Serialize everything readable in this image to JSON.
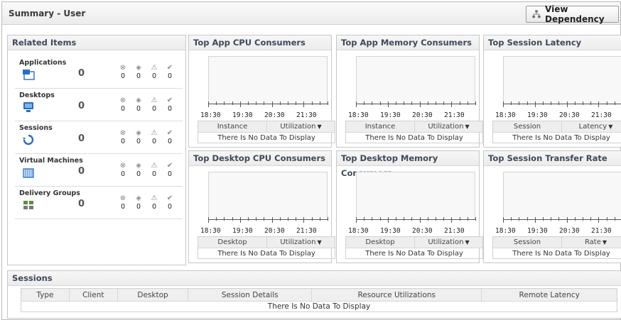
{
  "page": {
    "title": "Summary - User",
    "view_dependency_label": "View Dependency"
  },
  "related": {
    "title": "Related Items",
    "items": [
      {
        "name": "Applications",
        "icon": "applications-icon",
        "count": "0",
        "states": [
          "0",
          "0",
          "0",
          "0"
        ]
      },
      {
        "name": "Desktops",
        "icon": "desktops-icon",
        "count": "0",
        "states": [
          "0",
          "0",
          "0",
          "0"
        ]
      },
      {
        "name": "Sessions",
        "icon": "sessions-icon",
        "count": "0",
        "states": [
          "0",
          "0",
          "0",
          "0"
        ]
      },
      {
        "name": "Virtual Machines",
        "icon": "virtual-machines-icon",
        "count": "0",
        "states": [
          "0",
          "0",
          "0",
          "0"
        ]
      },
      {
        "name": "Delivery Groups",
        "icon": "delivery-groups-icon",
        "count": "0",
        "states": [
          "0",
          "0",
          "0",
          "0"
        ]
      }
    ],
    "state_icons": [
      "unknown-icon",
      "warning-diamond-icon",
      "warning-triangle-icon",
      "ok-check-icon"
    ]
  },
  "charts": [
    {
      "title": "Top App CPU Consumers",
      "col1": "Instance",
      "col2": "Utilization",
      "nodata": "There Is No Data To Display",
      "ticks": [
        "18:30",
        "19:30",
        "20:30",
        "21:30"
      ]
    },
    {
      "title": "Top App Memory Consumers",
      "col1": "Instance",
      "col2": "Utilization",
      "nodata": "There Is No Data To Display",
      "ticks": [
        "18:30",
        "19:30",
        "20:30",
        "21:30"
      ]
    },
    {
      "title": "Top Session Latency",
      "col1": "Session",
      "col2": "Latency",
      "nodata": "There Is No Data To Display",
      "ticks": [
        "18:30",
        "19:30",
        "20:30",
        "21:30"
      ]
    },
    {
      "title": "Top Desktop CPU Consumers",
      "col1": "Desktop",
      "col2": "Utilization",
      "nodata": "There Is No Data To Display",
      "ticks": [
        "18:30",
        "19:30",
        "20:30",
        "21:30"
      ]
    },
    {
      "title": "Top Desktop Memory Consumers",
      "col1": "Desktop",
      "col2": "Utilization",
      "nodata": "There Is No Data To Display",
      "ticks": [
        "18:30",
        "19:30",
        "20:30",
        "21:30"
      ]
    },
    {
      "title": "Top Session Transfer Rate",
      "col1": "Session",
      "col2": "Rate",
      "nodata": "There Is No Data To Display",
      "ticks": [
        "18:30",
        "19:30",
        "20:30",
        "21:30"
      ]
    }
  ],
  "sessions": {
    "title": "Sessions",
    "columns": [
      "Type",
      "Client",
      "Desktop",
      "Session Details",
      "Resource Utilizations",
      "Remote Latency"
    ],
    "nodata": "There Is No Data To Display"
  },
  "colors": {
    "header_text": "#3e4a5a",
    "icon_blue": "#2a6fc0"
  }
}
